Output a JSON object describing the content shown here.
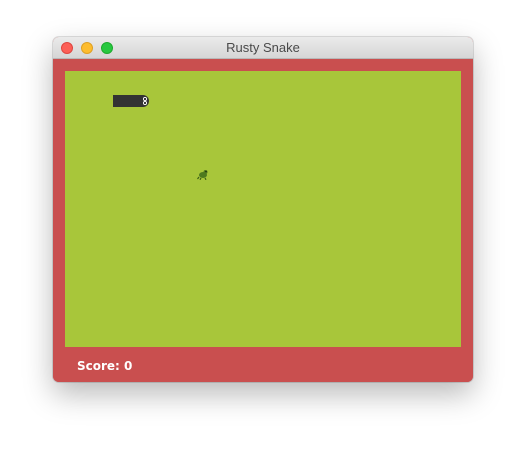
{
  "window": {
    "title": "Rusty Snake"
  },
  "game": {
    "score_label": "Score: 0",
    "score": 0,
    "colors": {
      "border": "#c94f4f",
      "field": "#a8c63a",
      "snake": "#333333",
      "food": "#4e7a1e"
    },
    "food_icon": "frog-icon"
  }
}
